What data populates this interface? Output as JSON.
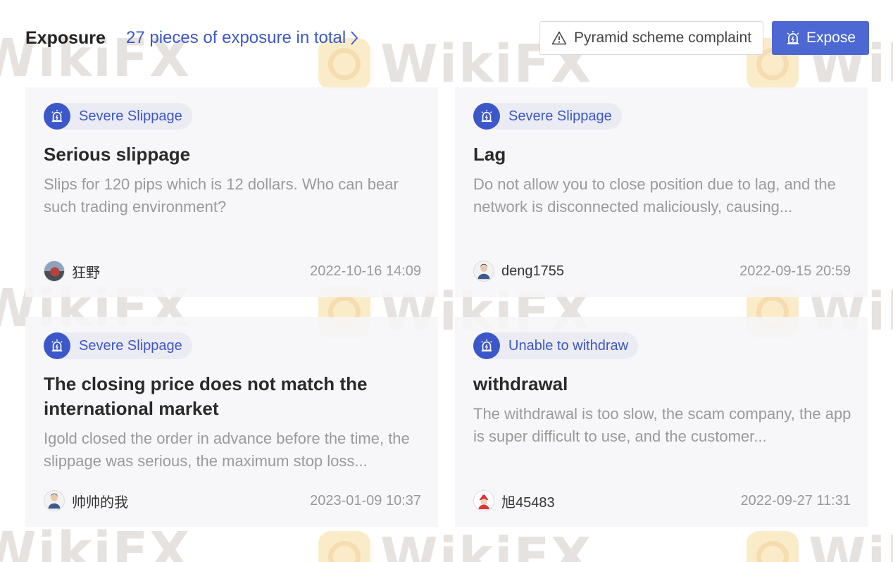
{
  "header": {
    "title": "Exposure",
    "total_link": "27 pieces of exposure in total",
    "complaint_button": "Pyramid scheme complaint",
    "expose_button": "Expose"
  },
  "watermark": "WikiFX",
  "cards": [
    {
      "tag": "Severe Slippage",
      "title": "Serious slippage",
      "description": "Slips for 120 pips which is 12 dollars. Who can bear such trading environment?",
      "author": "狂野",
      "date": "2022-10-16 14:09"
    },
    {
      "tag": "Severe Slippage",
      "title": "Lag",
      "description": "Do not allow you to close position due to lag, and the network is disconnected maliciously, causing...",
      "author": "deng1755",
      "date": "2022-09-15 20:59"
    },
    {
      "tag": "Severe Slippage",
      "title": "The closing price does not match the international market",
      "description": "Igold closed the order in advance before the time, the slippage was serious, the maximum stop loss...",
      "author": "帅帅的我",
      "date": "2023-01-09 10:37"
    },
    {
      "tag": "Unable to withdraw",
      "title": "withdrawal",
      "description": "The withdrawal is too slow, the scam company, the app is super difficult to use, and the customer...",
      "author": "旭45483",
      "date": "2022-09-27 11:31"
    }
  ],
  "colors": {
    "accent": "#3c57c8",
    "button": "#4d68d3",
    "card_bg": "#f6f6f8",
    "muted_text": "#9a9a9a"
  }
}
